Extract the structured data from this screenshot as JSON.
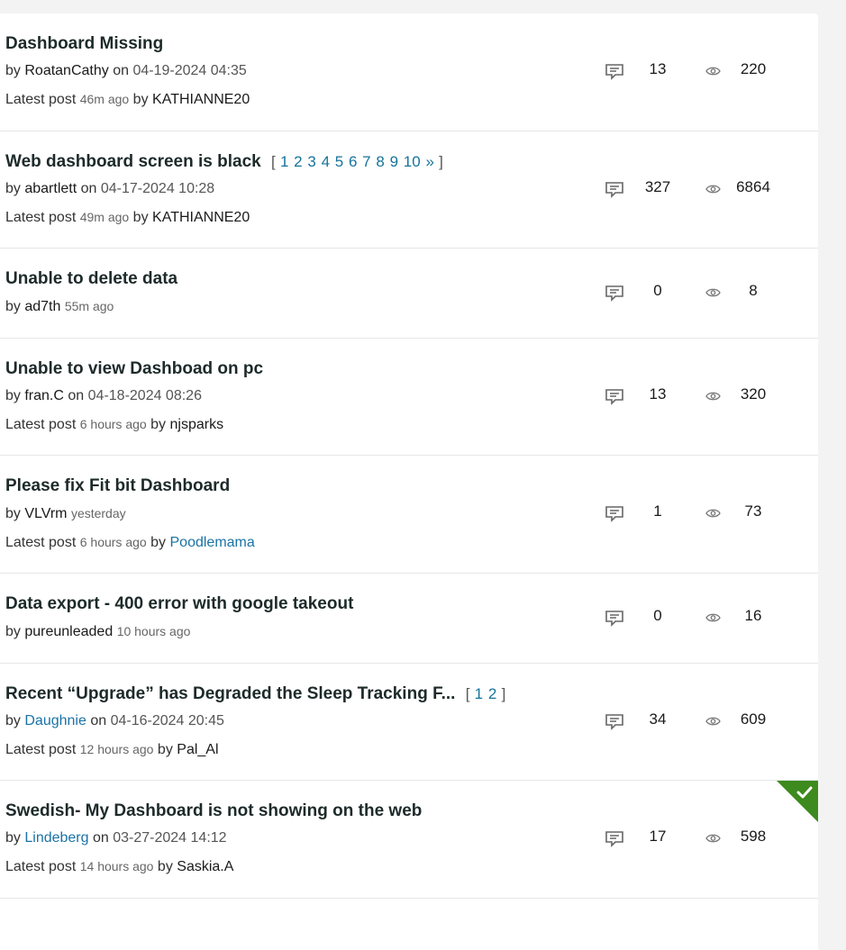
{
  "topics": [
    {
      "title": "Dashboard Missing",
      "by": "by",
      "author": "RoatanCathy",
      "on": "on",
      "date": "04-19-2024 04:35",
      "latest_prefix": "Latest post",
      "latest_time": "46m ago",
      "latest_by": "by",
      "latest_user": "KATHIANNE20",
      "replies": "13",
      "views": "220"
    },
    {
      "title": "Web dashboard screen is black",
      "pages": [
        "1",
        "2",
        "3",
        "4",
        "5",
        "6",
        "7",
        "8",
        "9",
        "10",
        "»"
      ],
      "by": "by",
      "author": "abartlett",
      "on": "on",
      "date": "04-17-2024 10:28",
      "latest_prefix": "Latest post",
      "latest_time": "49m ago",
      "latest_by": "by",
      "latest_user": "KATHIANNE20",
      "replies": "327",
      "views": "6864"
    },
    {
      "title": "Unable to delete data",
      "by": "by",
      "author": "ad7th",
      "time": "55m ago",
      "replies": "0",
      "views": "8"
    },
    {
      "title": "Unable to view Dashboad on pc",
      "by": "by",
      "author": "fran.C",
      "on": "on",
      "date": "04-18-2024 08:26",
      "latest_prefix": "Latest post",
      "latest_time": "6 hours ago",
      "latest_by": "by",
      "latest_user": "njsparks",
      "replies": "13",
      "views": "320"
    },
    {
      "title": "Please fix Fit bit Dashboard",
      "by": "by",
      "author": "VLVrm",
      "time": "yesterday",
      "latest_prefix": "Latest post",
      "latest_time": "6 hours ago",
      "latest_by": "by",
      "latest_user": "Poodlemama",
      "replies": "1",
      "views": "73"
    },
    {
      "title": "Data export - 400 error with google takeout",
      "by": "by",
      "author": "pureunleaded",
      "time": "10 hours ago",
      "replies": "0",
      "views": "16"
    },
    {
      "title": "Recent “Upgrade” has Degraded the Sleep Tracking F...",
      "pages": [
        "1",
        "2"
      ],
      "by": "by",
      "author": "Daughnie",
      "on": "on",
      "date": "04-16-2024 20:45",
      "latest_prefix": "Latest post",
      "latest_time": "12 hours ago",
      "latest_by": "by",
      "latest_user": "Pal_Al",
      "replies": "34",
      "views": "609"
    },
    {
      "title": "Swedish- My Dashboard is not showing on the web",
      "by": "by",
      "author": "Lindeberg",
      "on": "on",
      "date": "03-27-2024 14:12",
      "latest_prefix": "Latest post",
      "latest_time": "14 hours ago",
      "latest_by": "by",
      "latest_user": "Saskia.A",
      "replies": "17",
      "views": "598"
    }
  ],
  "pager_brackets": {
    "open": "[",
    "close": "]"
  },
  "icons": {
    "reply": "reply-icon",
    "view": "eye-icon",
    "solved": "checkmark-icon"
  },
  "colors": {
    "link": "#1a73a6",
    "solved": "#3d8a1e",
    "title": "#1e2a2a"
  }
}
